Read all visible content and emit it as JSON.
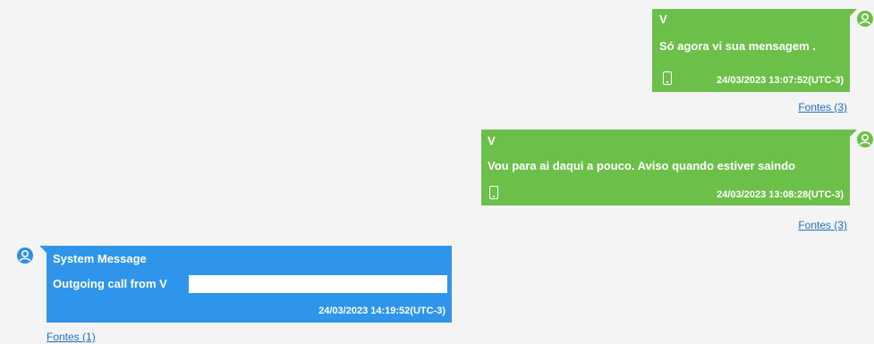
{
  "messages": [
    {
      "sender": "V",
      "text": "Só agora vi sua mensagem .",
      "timestamp": "24/03/2023 13:07:52(UTC-3)",
      "sources": "Fontes (3)",
      "direction": "outgoing",
      "color": "#6cc04a",
      "device_icon": "phone-icon"
    },
    {
      "sender": "V",
      "text": "Vou para ai daqui a pouco. Aviso quando estiver saindo",
      "timestamp": "24/03/2023 13:08:28(UTC-3)",
      "sources": "Fontes (3)",
      "direction": "outgoing",
      "color": "#6cc04a",
      "device_icon": "phone-icon"
    },
    {
      "sender": "System Message",
      "text": "Outgoing call from V",
      "timestamp": "24/03/2023 14:19:52(UTC-3)",
      "sources": "Fontes (1)",
      "direction": "incoming",
      "color": "#2f95ea",
      "avatar_icon": "user-avatar-icon"
    }
  ],
  "colors": {
    "outgoing_bubble": "#6cc04a",
    "system_bubble": "#2f95ea",
    "link": "#1a6fc2",
    "background": "#f4f4f4"
  }
}
